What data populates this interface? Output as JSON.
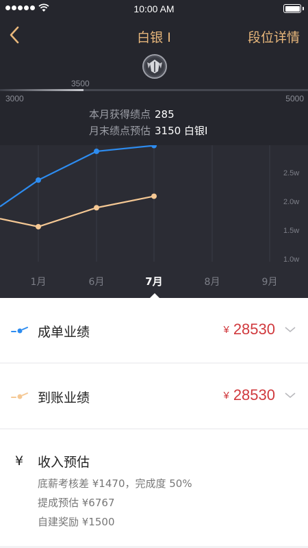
{
  "status_bar": {
    "time": "10:00 AM"
  },
  "nav": {
    "title": "白银 I",
    "right_label": "段位详情",
    "accent_color": "#e8b77b"
  },
  "rank_badge": {
    "icon": "rank-emblem-icon"
  },
  "progress": {
    "current_marker": "3500",
    "min": "3000",
    "max": "5000",
    "fraction": 0.27
  },
  "summary": {
    "month_points_label": "本月获得绩点",
    "month_points_value": "285",
    "forecast_label": "月末绩点预估",
    "forecast_value": "3150 白银I"
  },
  "chart_data": {
    "type": "line",
    "categories": [
      "1月",
      "6月",
      "7月",
      "8月",
      "9月"
    ],
    "selected": "7月",
    "y_ticks": [
      "2.5w",
      "2.0w",
      "1.5w",
      "1.0w"
    ],
    "ylim": [
      10000,
      30000
    ],
    "series": [
      {
        "color": "#2d8cf0",
        "values": [
          23700,
          28700,
          29700
        ]
      },
      {
        "color": "#f5c894",
        "values": [
          15600,
          18900,
          20900
        ]
      }
    ],
    "leading_values": {
      "blue": 19100,
      "orange": 17000
    }
  },
  "metrics": [
    {
      "label": "成单业绩",
      "currency": "¥",
      "value": "28530",
      "line_color": "#2d8cf0"
    },
    {
      "label": "到账业绩",
      "currency": "¥",
      "value": "28530",
      "line_color": "#f5c894"
    }
  ],
  "income": {
    "symbol": "¥",
    "title": "收入预估",
    "lines": [
      "底薪考核差 ¥1470，完成度 50%",
      "提成预估 ¥6767",
      "自建奖励 ¥1500"
    ]
  },
  "value_color": "#d0393d"
}
